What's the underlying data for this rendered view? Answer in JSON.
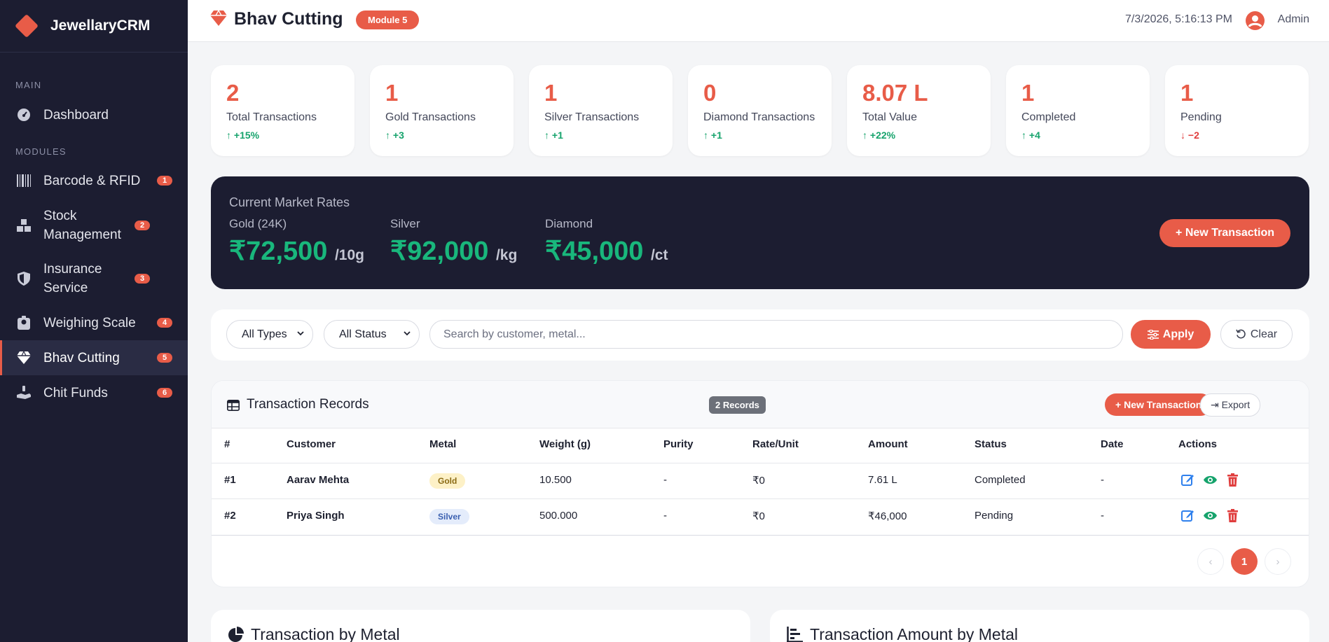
{
  "brand": {
    "name": "JewellaryCRM"
  },
  "sidebar": {
    "main_label": "MAIN",
    "modules_label": "MODULES",
    "items": [
      {
        "label": "Dashboard",
        "icon": "dashboard-icon",
        "badge": ""
      },
      {
        "label": "Barcode & RFID",
        "icon": "barcode-icon",
        "badge": "1"
      },
      {
        "label": "Stock Management",
        "icon": "boxes-icon",
        "badge": "2"
      },
      {
        "label": "Insurance Service",
        "icon": "shield-icon",
        "badge": "3"
      },
      {
        "label": "Weighing Scale",
        "icon": "scale-icon",
        "badge": "4"
      },
      {
        "label": "Bhav Cutting",
        "icon": "gem-icon",
        "badge": "5",
        "active": true
      },
      {
        "label": "Chit Funds",
        "icon": "hand-coin-icon",
        "badge": "6"
      }
    ]
  },
  "header": {
    "title": "Bhav Cutting",
    "module_badge": "Module 5",
    "datetime": "7/3/2026, 5:16:13 PM",
    "user": "Admin"
  },
  "stats": [
    {
      "value": "2",
      "label": "Total Transactions",
      "trend": "+15%",
      "dir": "up"
    },
    {
      "value": "1",
      "label": "Gold Transactions",
      "trend": "+3",
      "dir": "up"
    },
    {
      "value": "1",
      "label": "Silver Transactions",
      "trend": "+1",
      "dir": "up"
    },
    {
      "value": "0",
      "label": "Diamond Transactions",
      "trend": "+1",
      "dir": "up"
    },
    {
      "value": "8.07 L",
      "label": "Total Value",
      "trend": "+22%",
      "dir": "up"
    },
    {
      "value": "1",
      "label": "Completed",
      "trend": "+4",
      "dir": "up"
    },
    {
      "value": "1",
      "label": "Pending",
      "trend": "−2",
      "dir": "down"
    }
  ],
  "market": {
    "title": "Current Market Rates",
    "gold": {
      "label": "Gold (24K)",
      "value": "₹72,500",
      "unit": "/10g"
    },
    "silver": {
      "label": "Silver",
      "value": "₹92,000",
      "unit": "/kg"
    },
    "diamond": {
      "label": "Diamond",
      "value": "₹45,000",
      "unit": "/ct"
    },
    "button": "New Transaction"
  },
  "filters": {
    "type_value": "All Types",
    "status_value": "All Status",
    "search_placeholder": "Search by customer, metal...",
    "apply": "Apply",
    "clear": "Clear"
  },
  "records": {
    "title": "Transaction Records",
    "count": "2 Records",
    "new_button": "New Transaction",
    "export_button": "Export",
    "columns": [
      "#",
      "Customer",
      "Metal",
      "Weight (g)",
      "Purity",
      "Rate/Unit",
      "Amount",
      "Status",
      "Date",
      "Actions"
    ],
    "rows": [
      {
        "id": "#1",
        "customer": "Aarav Mehta",
        "metal": "Gold",
        "weight": "10.500",
        "purity": "-",
        "rate": "₹0",
        "amount": "7.61 L",
        "status": "Completed",
        "date": "-"
      },
      {
        "id": "#2",
        "customer": "Priya Singh",
        "metal": "Silver",
        "weight": "500.000",
        "purity": "-",
        "rate": "₹0",
        "amount": "₹46,000",
        "status": "Pending",
        "date": "-"
      }
    ],
    "current_page": "1"
  },
  "charts": {
    "left_title": "Transaction by Metal",
    "right_title": "Transaction Amount by Metal"
  },
  "colors": {
    "accent": "#e85c48",
    "sidebar_bg": "#1c1d31",
    "rate_green": "#19b77c",
    "trend_up": "#16a36c",
    "trend_down": "#e03d3d"
  }
}
